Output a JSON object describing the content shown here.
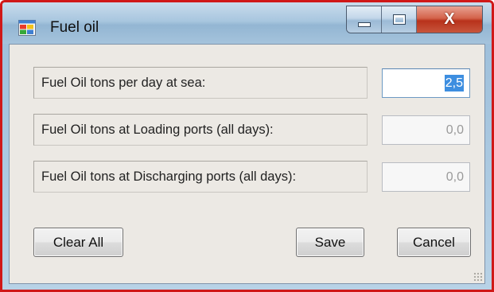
{
  "window": {
    "title": "Fuel oil",
    "icon": "app-window-icon",
    "controls": {
      "minimize": "minimize-icon",
      "maximize": "maximize-icon",
      "close": "X"
    }
  },
  "fields": [
    {
      "label": "Fuel Oil tons per day at sea:",
      "value": "2,5",
      "enabled": true,
      "selected": true
    },
    {
      "label": "Fuel Oil tons at Loading ports (all days):",
      "value": "0,0",
      "enabled": false
    },
    {
      "label": "Fuel Oil tons at Discharging ports  (all days):",
      "value": "0,0",
      "enabled": false
    }
  ],
  "buttons": {
    "clear_all": "Clear All",
    "save": "Save",
    "cancel": "Cancel"
  },
  "colors": {
    "window_border": "#d01818",
    "title_bar": "#a8c6df",
    "client_bg": "#ece9e4",
    "selection": "#3d8ee0",
    "close_button": "#c7553c"
  }
}
